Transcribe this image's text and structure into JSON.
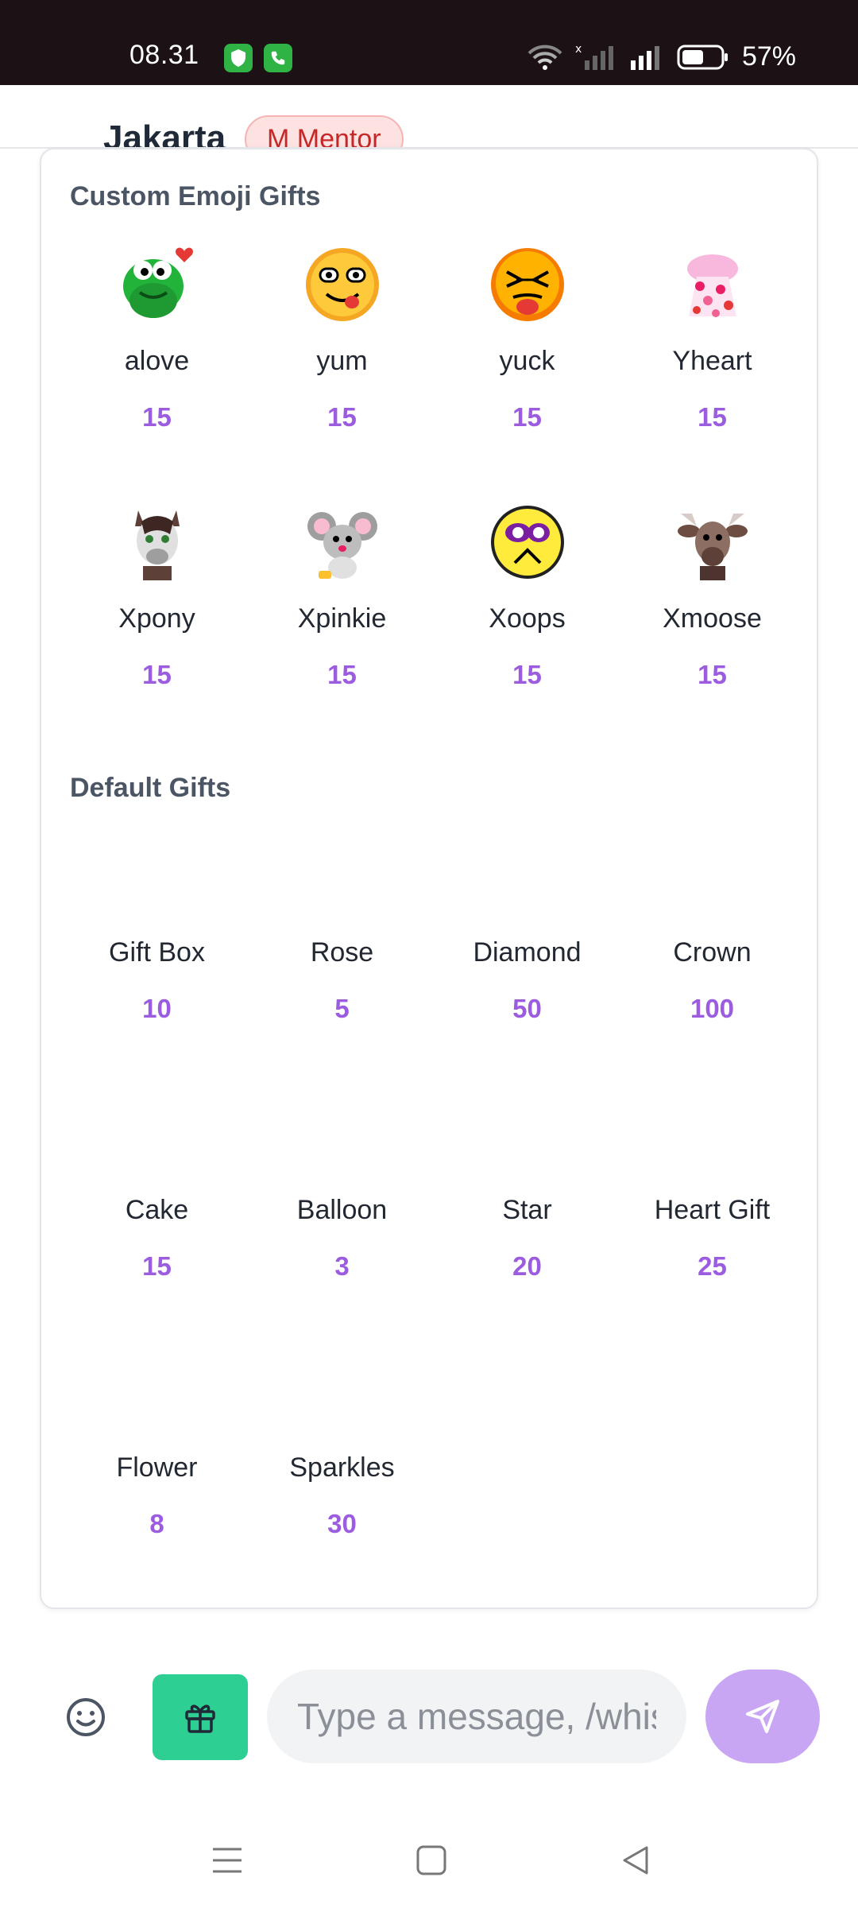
{
  "status_bar": {
    "time": "08.31",
    "battery": "57%"
  },
  "header": {
    "room_name": "Jakarta",
    "badge": "M Mentor"
  },
  "custom_section": {
    "title": "Custom Emoji Gifts",
    "items": [
      {
        "name": "alove",
        "price": "15",
        "icon": "green-frog-heart-emoji"
      },
      {
        "name": "yum",
        "price": "15",
        "icon": "yum-face-emoji"
      },
      {
        "name": "yuck",
        "price": "15",
        "icon": "yuck-face-emoji"
      },
      {
        "name": "Yheart",
        "price": "15",
        "icon": "pink-hearts-emoji"
      },
      {
        "name": "Xpony",
        "price": "15",
        "icon": "pony-emoji"
      },
      {
        "name": "Xpinkie",
        "price": "15",
        "icon": "mouse-emoji"
      },
      {
        "name": "Xoops",
        "price": "15",
        "icon": "oops-face-emoji"
      },
      {
        "name": "Xmoose",
        "price": "15",
        "icon": "moose-emoji"
      }
    ]
  },
  "default_section": {
    "title": "Default Gifts",
    "items": [
      {
        "name": "Gift Box",
        "price": "10"
      },
      {
        "name": "Rose",
        "price": "5"
      },
      {
        "name": "Diamond",
        "price": "50"
      },
      {
        "name": "Crown",
        "price": "100"
      },
      {
        "name": "Cake",
        "price": "15"
      },
      {
        "name": "Balloon",
        "price": "3"
      },
      {
        "name": "Star",
        "price": "20"
      },
      {
        "name": "Heart Gift",
        "price": "25"
      },
      {
        "name": "Flower",
        "price": "8"
      },
      {
        "name": "Sparkles",
        "price": "30"
      }
    ]
  },
  "input_bar": {
    "placeholder": "Type a message, /whisper"
  },
  "colors": {
    "price": "#9b5ce0",
    "gift_button": "#2ecf93",
    "send_button": "#c8a6f4"
  }
}
